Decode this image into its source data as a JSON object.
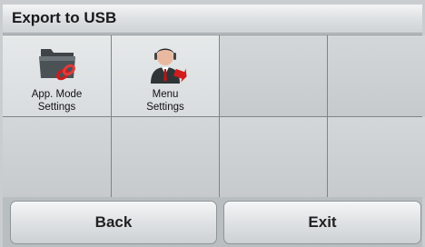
{
  "header": {
    "title": "Export to USB"
  },
  "menu": {
    "items": [
      {
        "label": "App. Mode\nSettings",
        "icon": "folder-link-icon"
      },
      {
        "label": "Menu\nSettings",
        "icon": "user-arrow-icon"
      }
    ]
  },
  "footer": {
    "back_label": "Back",
    "exit_label": "Exit"
  }
}
